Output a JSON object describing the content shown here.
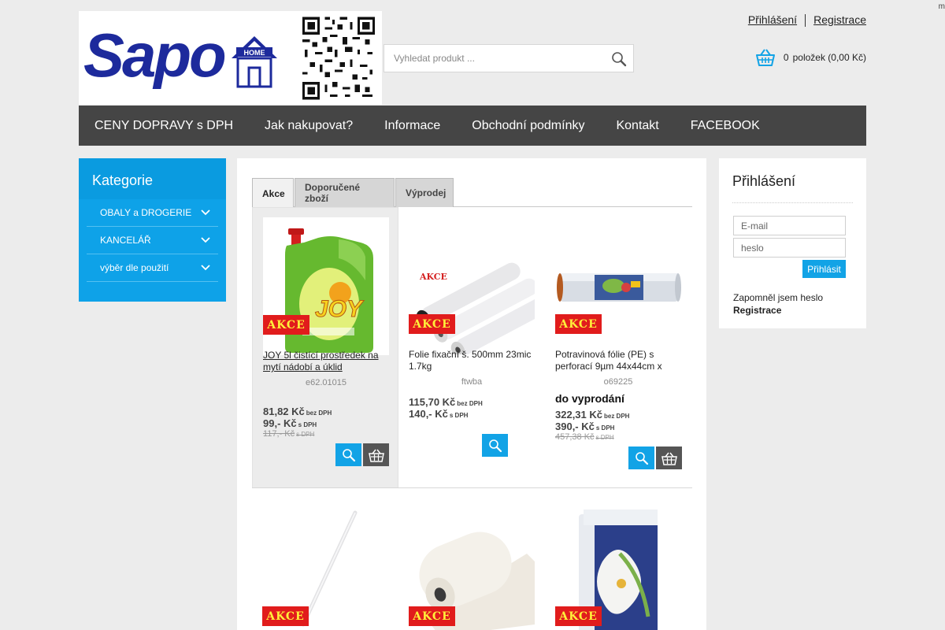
{
  "corner_mark": "m",
  "logo": {
    "text": "Sapo",
    "home_label": "HOME"
  },
  "search": {
    "placeholder": "Vyhledat produkt ..."
  },
  "auth_links": {
    "login": "Přihlášení",
    "register": "Registrace"
  },
  "cart": {
    "count": "0",
    "summary": "položek (0,00 Kč)"
  },
  "nav": [
    "CENY DOPRAVY s DPH",
    "Jak nakupovat?",
    "Informace",
    "Obchodní podmínky",
    "Kontakt",
    "FACEBOOK"
  ],
  "categories": {
    "title": "Kategorie",
    "items": [
      "OBALY a DROGERIE",
      "KANCELÁŘ",
      "výběr dle použití"
    ]
  },
  "tabs": [
    "Akce",
    "Doporučené zboží",
    "Výprodej"
  ],
  "badge_label": "AKCE",
  "products": [
    {
      "name": "JOY 5l čistící prostředek na mytí nádobí a úklid",
      "code": "e62.01015",
      "availability": "",
      "price_ex_vat": "81,82 Kč",
      "price_ex_vat_label": "bez DPH",
      "price_inc_vat": "99,- Kč",
      "price_inc_vat_label": "s DPH",
      "price_old": "117,- Kč",
      "price_old_label": "s DPH"
    },
    {
      "name": "Folie fixační š. 500mm 23mic 1.7kg",
      "code": "ftwba",
      "availability": "",
      "price_ex_vat": "115,70 Kč",
      "price_ex_vat_label": "bez DPH",
      "price_inc_vat": "140,- Kč",
      "price_inc_vat_label": "s DPH",
      "price_old": "",
      "price_old_label": ""
    },
    {
      "name": "Potravinová fólie (PE) s perforací 9µm 44x44cm x",
      "code": "o69225",
      "availability": "do vyprodání",
      "price_ex_vat": "322,31 Kč",
      "price_ex_vat_label": "bez DPH",
      "price_inc_vat": "390,- Kč",
      "price_inc_vat_label": "s DPH",
      "price_old": "457,38 Kč",
      "price_old_label": "s DPH"
    }
  ],
  "login_panel": {
    "title": "Přihlášení",
    "email_placeholder": "E-mail",
    "password_placeholder": "heslo",
    "submit": "Přihlásit",
    "forgot": "Zapomněl jsem heslo",
    "register": "Registrace"
  },
  "colors": {
    "accent": "#12a3e6",
    "nav_bg": "#454545",
    "badge_bg": "#e11c1c",
    "badge_text": "#ffef3a",
    "logo": "#1d2a9c"
  }
}
